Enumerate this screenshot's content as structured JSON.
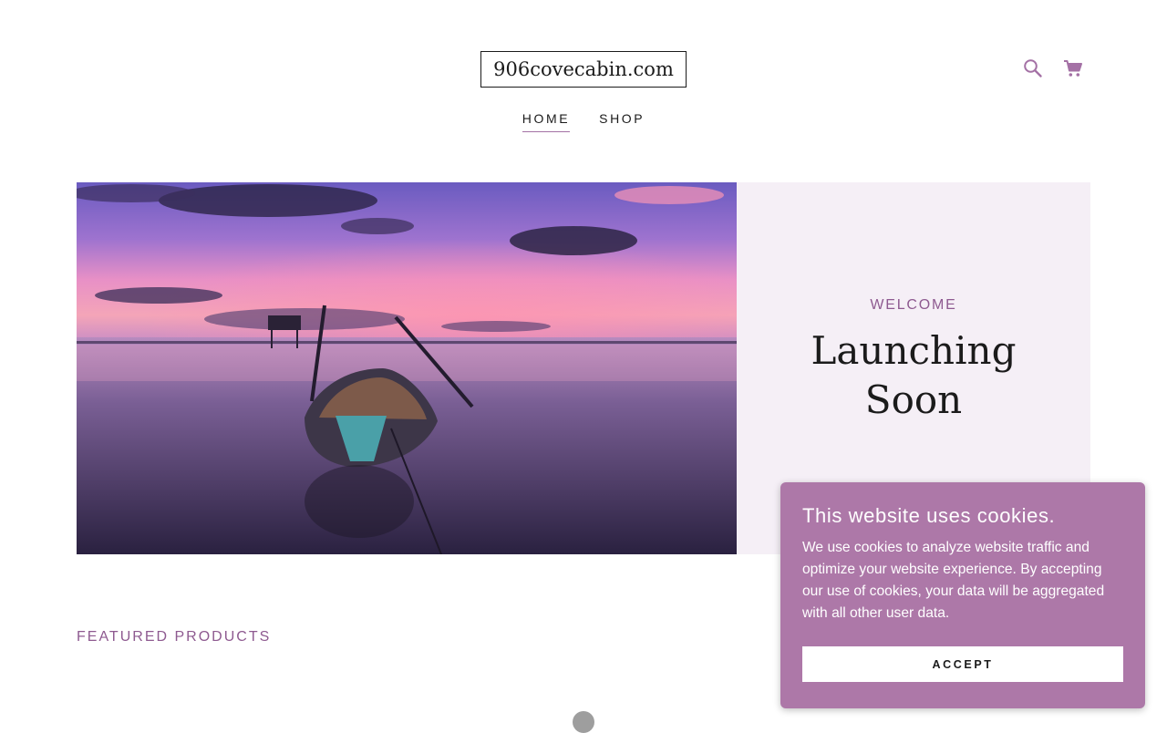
{
  "header": {
    "logo_text": "906covecabin.com",
    "icons": [
      "search-icon",
      "cart-icon"
    ],
    "accent_color": "#a471a5"
  },
  "nav": {
    "items": [
      {
        "label": "HOME",
        "active": true
      },
      {
        "label": "SHOP",
        "active": false
      }
    ]
  },
  "hero": {
    "eyebrow": "WELCOME",
    "headline": "Launching Soon",
    "panel_color": "#f5eff6"
  },
  "featured": {
    "heading": "FEATURED PRODUCTS"
  },
  "cookie_banner": {
    "title": "This website uses cookies.",
    "body": "We use cookies to analyze website traffic and optimize your website experience. By accepting our use of cookies, your data will be aggregated with all other user data.",
    "accept_label": "ACCEPT",
    "background_color": "#ad78a8"
  }
}
